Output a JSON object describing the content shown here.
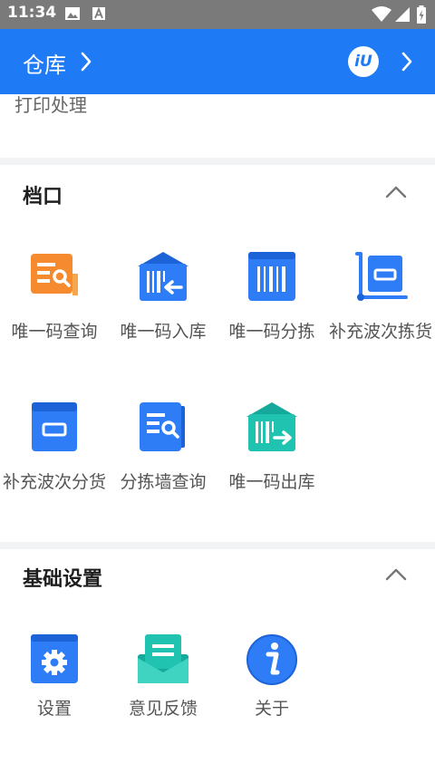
{
  "status_bar": {
    "time": "11:34",
    "icons": [
      "image-icon",
      "a-notification-icon",
      "wifi-icon",
      "signal-icon",
      "battery-charging-icon"
    ]
  },
  "header": {
    "title": "仓库",
    "logo_text": "iU",
    "color": "#1f7bf5"
  },
  "partial_section": {
    "item_label": "打印处理"
  },
  "sections": [
    {
      "title": "档口",
      "items": [
        {
          "label": "唯一码查询",
          "icon": "unique-code-query-icon"
        },
        {
          "label": "唯一码入库",
          "icon": "unique-code-inbound-icon"
        },
        {
          "label": "唯一码分拣",
          "icon": "unique-code-sort-icon"
        },
        {
          "label": "补充波次拣货",
          "icon": "wave-picking-icon"
        },
        {
          "label": "补充波次分货",
          "icon": "wave-distribution-icon"
        },
        {
          "label": "分拣墙查询",
          "icon": "sorting-wall-query-icon"
        },
        {
          "label": "唯一码出库",
          "icon": "unique-code-outbound-icon"
        }
      ]
    },
    {
      "title": "基础设置",
      "items": [
        {
          "label": "设置",
          "icon": "settings-icon"
        },
        {
          "label": "意见反馈",
          "icon": "feedback-icon"
        },
        {
          "label": "关于",
          "icon": "about-info-icon"
        }
      ]
    }
  ],
  "colors": {
    "blue": "#2f7df6",
    "orange": "#f58a2e",
    "teal": "#20c2b0",
    "background_gap": "#f2f3f5"
  }
}
